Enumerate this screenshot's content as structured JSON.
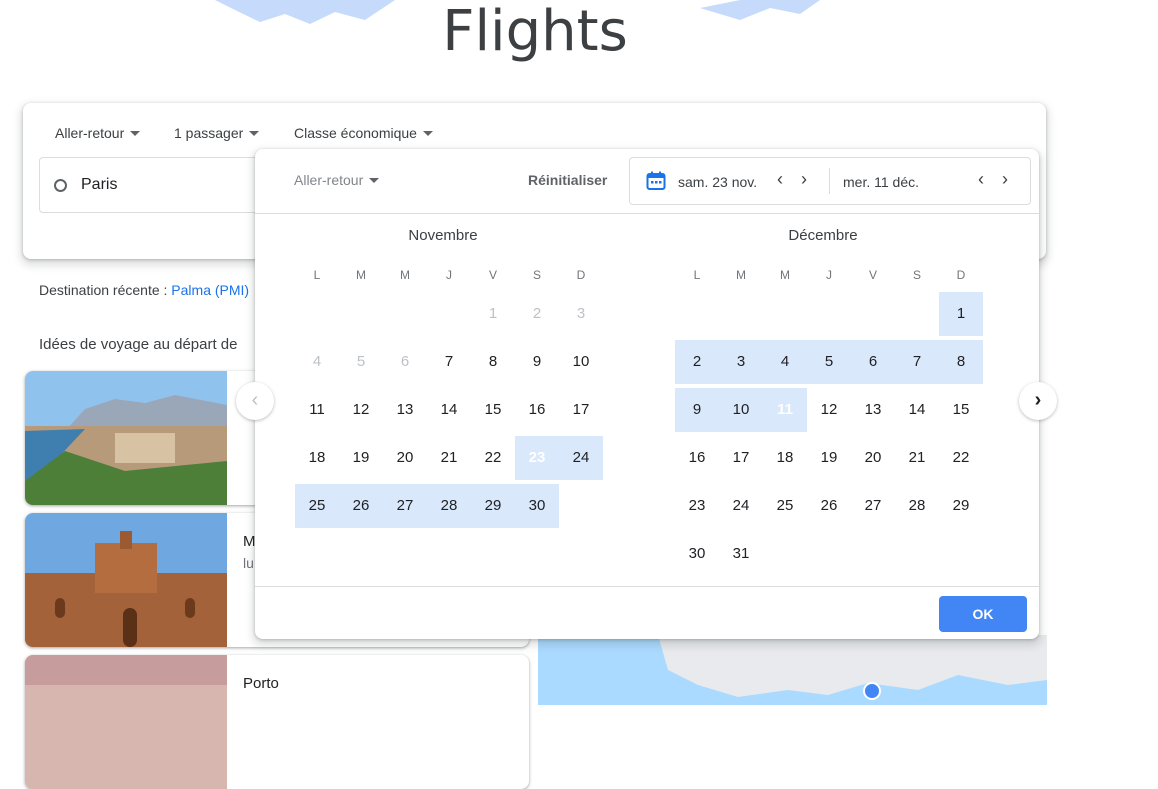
{
  "page": {
    "title": "Flights"
  },
  "search": {
    "trip_type": "Aller-retour",
    "passengers": "1 passager",
    "cabin": "Classe économique",
    "origin": "Paris"
  },
  "recent": {
    "label": "Destination récente :",
    "link": "Palma (PMI)"
  },
  "ideas": {
    "label": "Idées de voyage au départ de"
  },
  "cards": [
    {
      "name": "",
      "sub": ""
    },
    {
      "name": "M",
      "sub": "lu"
    },
    {
      "name": "Porto",
      "sub": ""
    }
  ],
  "picker": {
    "trip_type": "Aller-retour",
    "reset": "Réinitialiser",
    "depart": "sam. 23 nov.",
    "return": "mer. 11 déc.",
    "ok": "OK",
    "weekdays": [
      "L",
      "M",
      "M",
      "J",
      "V",
      "S",
      "D"
    ],
    "months": [
      {
        "name": "Novembre",
        "first_weekday": 4,
        "days": 30,
        "disabled_through": 6,
        "selected": 23,
        "range": [
          23,
          30
        ]
      },
      {
        "name": "Décembre",
        "first_weekday": 6,
        "days": 31,
        "disabled_through": 0,
        "selected": 11,
        "range": [
          1,
          11
        ]
      }
    ]
  },
  "colors": {
    "accent": "#1a73e8",
    "range": "#d9e8fb",
    "ok_button": "#4285f4"
  }
}
